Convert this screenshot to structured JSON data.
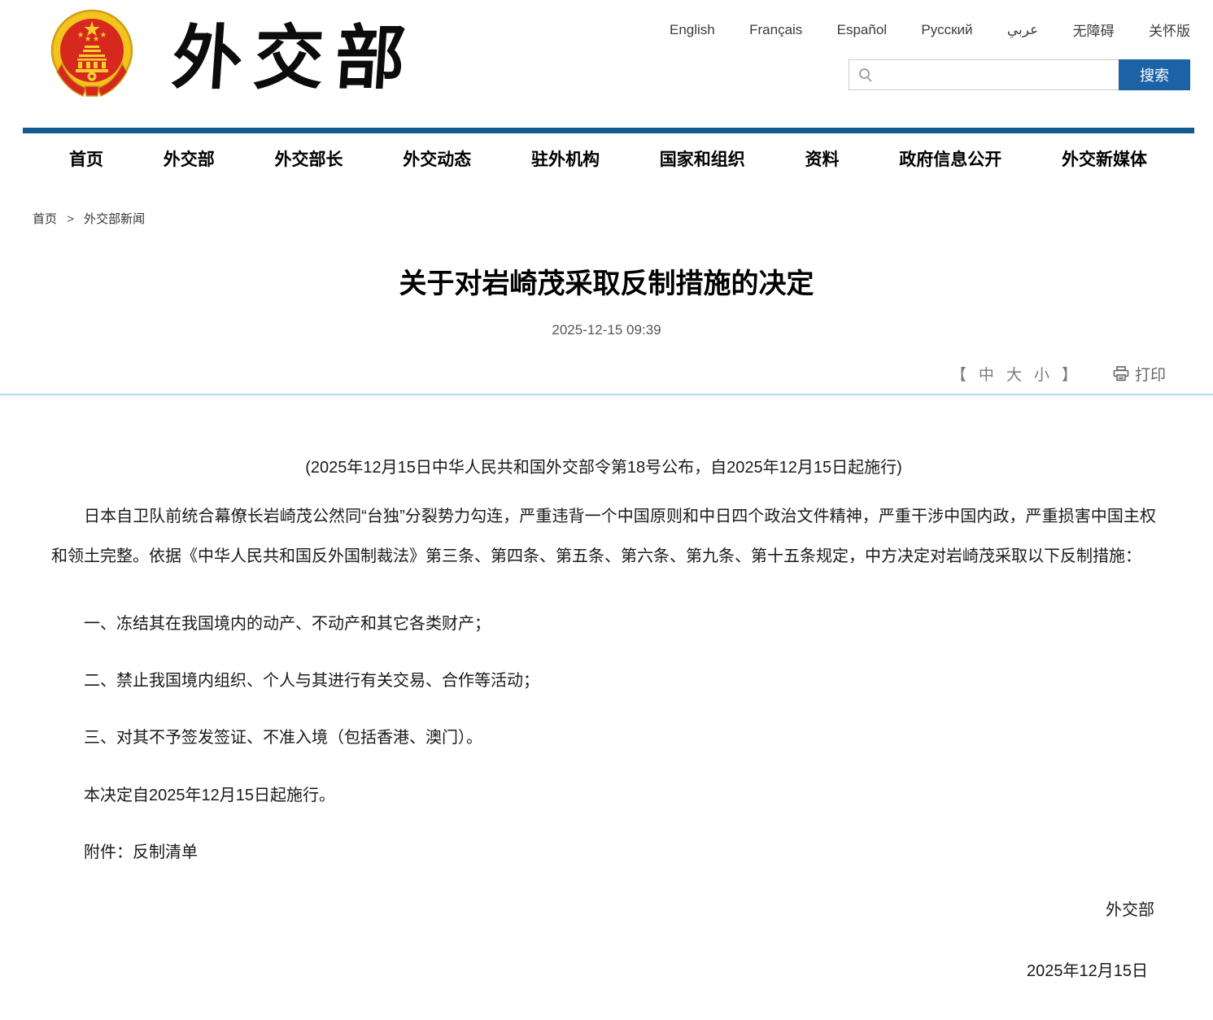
{
  "header": {
    "site_name": "外交部",
    "languages": [
      "English",
      "Français",
      "Español",
      "Русский",
      "عربي",
      "无障碍",
      "关怀版"
    ],
    "search": {
      "button_label": "搜索"
    }
  },
  "nav": {
    "items": [
      "首页",
      "外交部",
      "外交部长",
      "外交动态",
      "驻外机构",
      "国家和组织",
      "资料",
      "政府信息公开",
      "外交新媒体"
    ]
  },
  "breadcrumb": {
    "home": "首页",
    "separator": ">",
    "section": "外交部新闻"
  },
  "article": {
    "title": "关于对岩崎茂采取反制措施的决定",
    "datetime": "2025-12-15 09:39",
    "font_controls": {
      "open": "【",
      "medium": "中",
      "large": "大",
      "small": "小",
      "close": "】"
    },
    "print_label": "打印",
    "intro": "(2025年12月15日中华人民共和国外交部令第18号公布，自2025年12月15日起施行)",
    "paragraph1": "日本自卫队前统合幕僚长岩崎茂公然同“台独”分裂势力勾连，严重违背一个中国原则和中日四个政治文件精神，严重干涉中国内政，严重损害中国主权和领土完整。依据《中华人民共和国反外国制裁法》第三条、第四条、第五条、第六条、第九条、第十五条规定，中方决定对岩崎茂采取以下反制措施：",
    "measures": [
      "一、冻结其在我国境内的动产、不动产和其它各类财产；",
      "二、禁止我国境内组织、个人与其进行有关交易、合作等活动；",
      "三、对其不予签发签证、不准入境（包括香港、澳门）。"
    ],
    "effective": "本决定自2025年12月15日起施行。",
    "attachment": "附件：反制清单",
    "signature": "外交部",
    "sign_date": "2025年12月15日"
  },
  "colors": {
    "nav_accent": "#15598f",
    "search_button": "#1c63a5",
    "divider": "#b3d7ea",
    "emblem_red": "#d7281e",
    "emblem_gold": "#f2c41d"
  }
}
